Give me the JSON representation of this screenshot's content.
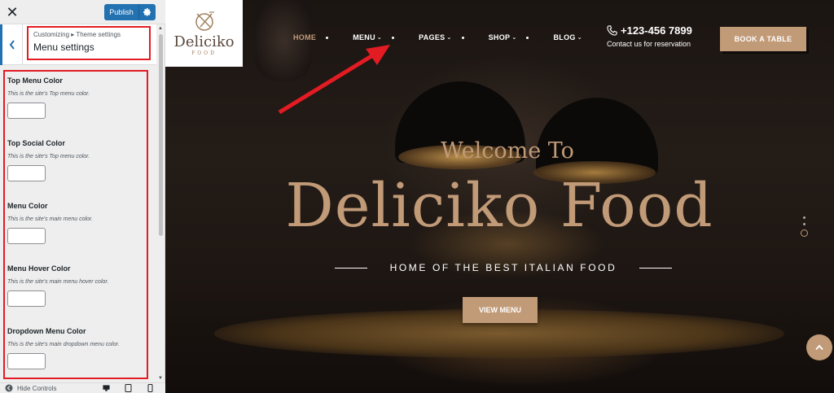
{
  "customizer": {
    "close_symbol": "✕",
    "publish_label": "Publish",
    "breadcrumb": "Customizing ▸ Theme settings",
    "section_title": "Menu settings",
    "controls": [
      {
        "title": "Top Menu Color",
        "desc": "This is the site's Top menu color."
      },
      {
        "title": "Top Social Color",
        "desc": "This is the site's Top menu color."
      },
      {
        "title": "Menu Color",
        "desc": "This is the site's main menu color."
      },
      {
        "title": "Menu Hover Color",
        "desc": "This is the site's main menu hover color."
      },
      {
        "title": "Dropdown Menu Color",
        "desc": "This is the site's main dropdown menu color."
      }
    ],
    "hide_controls_label": "Hide Controls"
  },
  "site": {
    "logo_name": "Deliciko",
    "logo_sub": "FOOD",
    "nav": [
      {
        "label": "HOME",
        "active": true
      },
      {
        "label": "MENU",
        "caret": true
      },
      {
        "label": "PAGES",
        "caret": true
      },
      {
        "label": "SHOP",
        "caret": true
      },
      {
        "label": "BLOG",
        "caret": true
      }
    ],
    "phone": "+123-456 7899",
    "phone_sub": "Contact us for reservation",
    "book_button": "BOOK A TABLE",
    "hero_welcome": "Welcome To",
    "hero_title": "Deliciko Food",
    "hero_sub": "HOME OF THE BEST ITALIAN FOOD",
    "view_button": "VIEW MENU"
  },
  "colors": {
    "accent": "#c19a77",
    "wp_blue": "#2271b1",
    "annotation_red": "#e31b23"
  },
  "icons": [
    "close-icon",
    "gear-icon",
    "chevron-left-icon",
    "phone-icon",
    "desktop-icon",
    "tablet-icon",
    "mobile-icon",
    "arrow-up-icon",
    "eye-icon"
  ]
}
